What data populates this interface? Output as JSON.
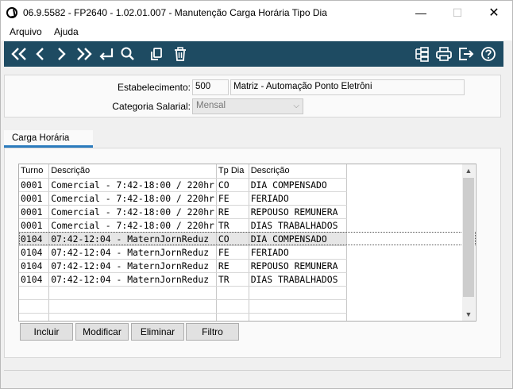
{
  "window": {
    "title": "06.9.5582 - FP2640 - 1.02.01.007 - Manutenção Carga Horária Tipo Dia",
    "minimize_glyph": "—",
    "maximize_glyph": "☐",
    "close_glyph": "✕"
  },
  "menu": {
    "arquivo": "Arquivo",
    "ajuda": "Ajuda"
  },
  "toolbar": {
    "icons": [
      "first-record-icon",
      "previous-record-icon",
      "next-record-icon",
      "last-record-icon",
      "enter-icon",
      "search-icon",
      "copy-icon",
      "delete-icon",
      "structure-icon",
      "print-icon",
      "exit-icon",
      "help-icon"
    ],
    "color": "#1e4b62",
    "icon_color": "#ffffff"
  },
  "form": {
    "estabelecimento_label": "Estabelecimento:",
    "estabelecimento_code": "500",
    "estabelecimento_name": "Matriz - Automação Ponto Eletrôni",
    "categoria_label": "Categoria Salarial:",
    "categoria_value": "Mensal"
  },
  "tabs": {
    "carga_horaria": "Carga Horária"
  },
  "grid": {
    "columns": [
      "Turno",
      "Descrição",
      "Tp Dia",
      "Descrição"
    ],
    "rows": [
      [
        "0001",
        "Comercial - 7:42-18:00 / 220hr",
        "CO",
        "DIA COMPENSADO"
      ],
      [
        "0001",
        "Comercial - 7:42-18:00 / 220hr",
        "FE",
        "FERIADO"
      ],
      [
        "0001",
        "Comercial - 7:42-18:00 / 220hr",
        "RE",
        "REPOUSO REMUNERA"
      ],
      [
        "0001",
        "Comercial - 7:42-18:00 / 220hr",
        "TR",
        "DIAS TRABALHADOS"
      ],
      [
        "0104",
        "07:42-12:04 - MaternJornReduz",
        "CO",
        "DIA COMPENSADO"
      ],
      [
        "0104",
        "07:42-12:04 - MaternJornReduz",
        "FE",
        "FERIADO"
      ],
      [
        "0104",
        "07:42-12:04 - MaternJornReduz",
        "RE",
        "REPOUSO REMUNERA"
      ],
      [
        "0104",
        "07:42-12:04 - MaternJornReduz",
        "TR",
        "DIAS TRABALHADOS"
      ]
    ],
    "selected_row": 4,
    "accent": "#2b7bbd"
  },
  "buttons": {
    "incluir": "Incluir",
    "modificar": "Modificar",
    "eliminar": "Eliminar",
    "filtro": "Filtro"
  }
}
